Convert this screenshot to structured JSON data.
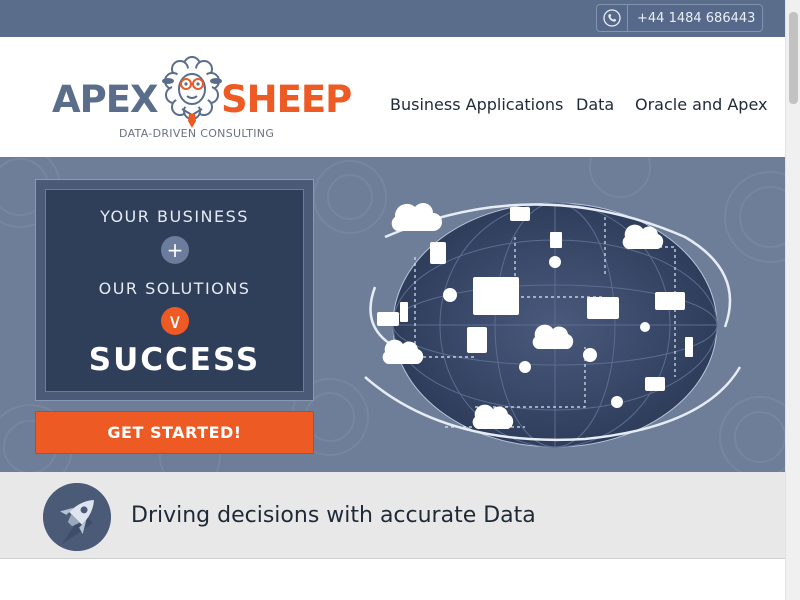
{
  "topbar": {
    "phone_icon": "phone-icon",
    "phone_number": "+44 1484 686443"
  },
  "header": {
    "logo": {
      "word_left": "APEX",
      "word_right": "SHEEP",
      "tagline": "DATA-DRIVEN CONSULTING",
      "mascot_icon": "sheep-mascot-icon"
    },
    "nav": [
      {
        "label": "Business Applications"
      },
      {
        "label": "Data"
      },
      {
        "label": "Oracle and Apex"
      }
    ]
  },
  "hero": {
    "line1": "YOUR BUSINESS",
    "plus_symbol": "+",
    "line2": "OUR SOLUTIONS",
    "arrow_symbol": "∨",
    "result": "SUCCESS",
    "cta_label": "GET STARTED!",
    "illustration_icon": "cloud-network-globe-icon"
  },
  "band": {
    "icon": "rocket-icon",
    "title": "Driving decisions with accurate Data"
  },
  "colors": {
    "topbar": "#5a6e8c",
    "brand_blue": "#5a6e8c",
    "brand_orange": "#ee5a24",
    "hero_bg": "#6e7e99",
    "panel_bg": "#2f3e59",
    "band_bg": "#e8e8e8"
  }
}
